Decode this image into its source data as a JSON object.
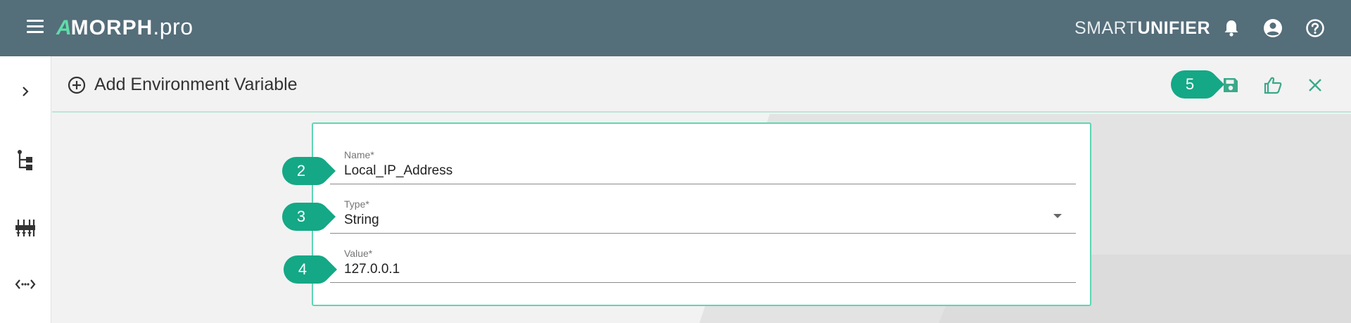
{
  "app": {
    "logo": {
      "a": "A",
      "morph": "MORPH",
      "pro": ".pro"
    },
    "brand": {
      "light": "SMART",
      "bold": "UNIFIER"
    }
  },
  "header": {
    "title": "Add Environment Variable"
  },
  "form": {
    "fields": [
      {
        "label": "Name*",
        "value": "Local_IP_Address"
      },
      {
        "label": "Type*",
        "value": "String"
      },
      {
        "label": "Value*",
        "value": "127.0.0.1"
      }
    ]
  },
  "callouts": [
    "2",
    "3",
    "4",
    "5"
  ],
  "colors": {
    "topbar": "#546e7a",
    "accent": "#5cd6b4",
    "callout": "#14a886",
    "icon_green": "#3aa98a"
  },
  "icons": {
    "top": [
      "menu-icon",
      "bell-icon",
      "account-circle-icon",
      "help-circle-icon"
    ],
    "sidebar": [
      "chevron-right-icon",
      "tree-structure-icon",
      "equalizer-icon",
      "code-arrows-icon"
    ],
    "header": [
      "add-circle-icon",
      "save-icon",
      "thumb-up-icon",
      "close-icon"
    ]
  }
}
